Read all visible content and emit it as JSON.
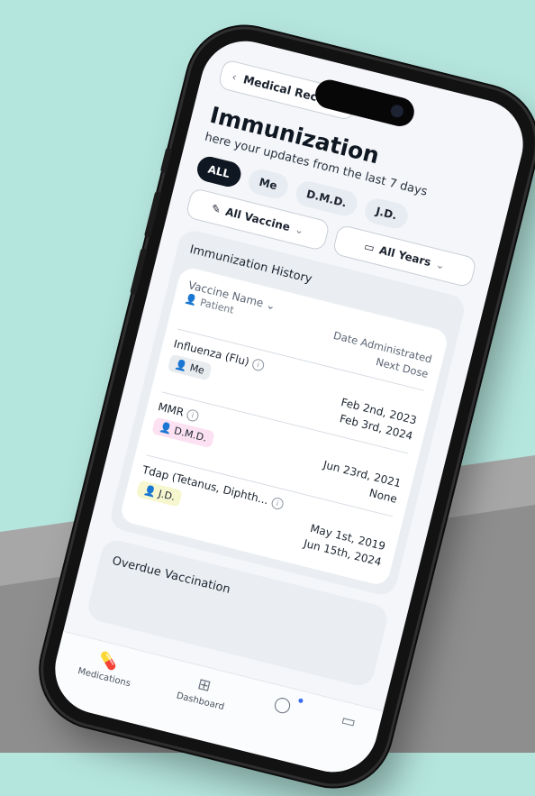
{
  "header": {
    "back_label": "Medical Records",
    "title": "Immunization",
    "subtitle": "here your updates from the last 7 days"
  },
  "filters": {
    "chips": [
      {
        "label": "ALL",
        "active": true
      },
      {
        "label": "Me",
        "active": false
      },
      {
        "label": "D.M.D.",
        "active": false
      },
      {
        "label": "J.D.",
        "active": false
      }
    ],
    "vaccine_select": "All Vaccine",
    "year_select": "All Years"
  },
  "history": {
    "title": "Immunization History",
    "col_vaccine": "Vaccine Name",
    "col_patient": "Patient",
    "col_date": "Date Administrated",
    "col_next": "Next Dose",
    "rows": [
      {
        "vaccine": "Influenza (Flu)",
        "patient": "Me",
        "badge_color": "#e9ecef",
        "date": "Feb 2nd, 2023",
        "next": "Feb 3rd, 2024"
      },
      {
        "vaccine": "MMR",
        "patient": "D.M.D.",
        "badge_color": "#fbe1f1",
        "date": "Jun 23rd, 2021",
        "next": "None"
      },
      {
        "vaccine": "Tdap (Tetanus, Diphth...",
        "patient": "J.D.",
        "badge_color": "#f6f7cf",
        "date": "May 1st, 2019",
        "next": "Jun 15th, 2024"
      }
    ]
  },
  "overdue": {
    "title": "Overdue Vaccination"
  },
  "tabbar": {
    "tabs": [
      {
        "label": "Medications",
        "icon": "pill-icon"
      },
      {
        "label": "Dashboard",
        "icon": "grid-icon"
      },
      {
        "label": "",
        "icon": "chat-icon"
      }
    ]
  },
  "colors": {
    "background": "#b5e6de",
    "accent": "#0f1722"
  }
}
